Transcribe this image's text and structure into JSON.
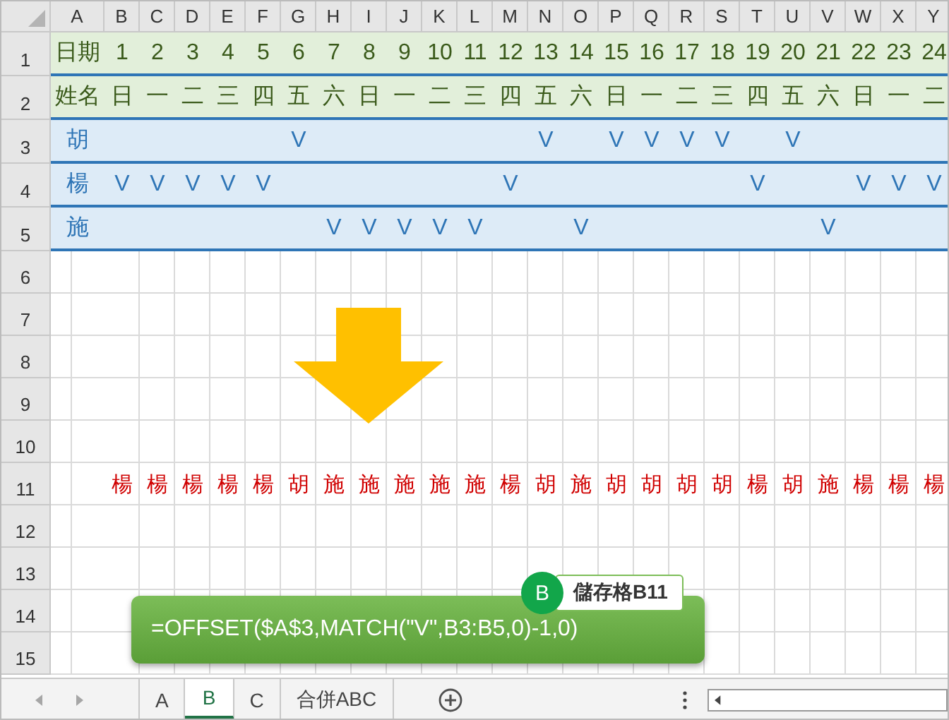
{
  "columns": [
    "A",
    "B",
    "C",
    "D",
    "E",
    "F",
    "G",
    "H",
    "I",
    "J",
    "K",
    "L",
    "M",
    "N",
    "O",
    "P",
    "Q",
    "R",
    "S",
    "T",
    "U",
    "V",
    "W",
    "X",
    "Y"
  ],
  "rows": [
    {
      "number": "1",
      "kind": "header",
      "cells": [
        "日期",
        "1",
        "2",
        "3",
        "4",
        "5",
        "6",
        "7",
        "8",
        "9",
        "10",
        "11",
        "12",
        "13",
        "14",
        "15",
        "16",
        "17",
        "18",
        "19",
        "20",
        "21",
        "22",
        "23",
        "24"
      ]
    },
    {
      "number": "2",
      "kind": "header",
      "cells": [
        "姓名",
        "日",
        "一",
        "二",
        "三",
        "四",
        "五",
        "六",
        "日",
        "一",
        "二",
        "三",
        "四",
        "五",
        "六",
        "日",
        "一",
        "二",
        "三",
        "四",
        "五",
        "六",
        "日",
        "一",
        "二"
      ]
    },
    {
      "number": "3",
      "kind": "person",
      "cells": [
        "胡",
        null,
        null,
        null,
        null,
        null,
        "V",
        null,
        null,
        null,
        null,
        null,
        null,
        "V",
        null,
        "V",
        "V",
        "V",
        "V",
        null,
        "V",
        null,
        null,
        null,
        null
      ]
    },
    {
      "number": "4",
      "kind": "person",
      "cells": [
        "楊",
        "V",
        "V",
        "V",
        "V",
        "V",
        null,
        null,
        null,
        null,
        null,
        null,
        "V",
        null,
        null,
        null,
        null,
        null,
        null,
        "V",
        null,
        null,
        "V",
        "V",
        "V"
      ]
    },
    {
      "number": "5",
      "kind": "person",
      "cells": [
        "施",
        null,
        null,
        null,
        null,
        null,
        null,
        "V",
        "V",
        "V",
        "V",
        "V",
        null,
        null,
        "V",
        null,
        null,
        null,
        null,
        null,
        null,
        "V",
        null,
        null,
        null
      ]
    },
    {
      "number": "6",
      "kind": "empty"
    },
    {
      "number": "7",
      "kind": "empty"
    },
    {
      "number": "8",
      "kind": "empty"
    },
    {
      "number": "9",
      "kind": "empty"
    },
    {
      "number": "10",
      "kind": "empty"
    },
    {
      "number": "11",
      "kind": "result",
      "cells": [
        null,
        "楊",
        "楊",
        "楊",
        "楊",
        "楊",
        "胡",
        "施",
        "施",
        "施",
        "施",
        "施",
        "楊",
        "胡",
        "施",
        "胡",
        "胡",
        "胡",
        "胡",
        "楊",
        "胡",
        "施",
        "楊",
        "楊",
        "楊"
      ]
    },
    {
      "number": "12",
      "kind": "empty"
    },
    {
      "number": "13",
      "kind": "empty"
    },
    {
      "number": "14",
      "kind": "empty"
    },
    {
      "number": "15",
      "kind": "empty"
    }
  ],
  "callout": {
    "formula": "=OFFSET($A$3,MATCH(\"V\",B3:B5,0)-1,0)",
    "badge": "B",
    "label": "儲存格B11"
  },
  "sheet_tabs": [
    {
      "label": "A",
      "selected": false
    },
    {
      "label": "B",
      "selected": true
    },
    {
      "label": "C",
      "selected": false
    },
    {
      "label": "合併ABC",
      "selected": false
    }
  ]
}
